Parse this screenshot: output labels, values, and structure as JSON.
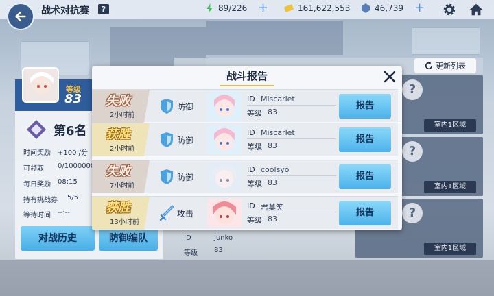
{
  "header": {
    "title": "战术对抗赛",
    "help": "?",
    "stamina": "89/226",
    "coins": "161,622,553",
    "gems": "46,739"
  },
  "player": {
    "level_label": "等级",
    "level": "83",
    "rank": "第6名"
  },
  "stats": [
    {
      "label": "时间奖励",
      "value": "+100 /分"
    },
    {
      "label": "可领取",
      "value": "0/1000000"
    },
    {
      "label": "每日奖励",
      "value": "08:15"
    },
    {
      "label": "持有挑战券",
      "value": "5/5"
    },
    {
      "label": "等待时间",
      "value": "--:--"
    }
  ],
  "buttons": {
    "history": "对战历史",
    "defense": "防御编队",
    "refresh": "更新列表"
  },
  "right_cards": {
    "question": "?",
    "area": "室内1区域",
    "bottom_id_label": "ID",
    "bottom_id": "Junko",
    "bottom_lv_label": "等级",
    "bottom_lv": "83"
  },
  "modal": {
    "title": "战斗报告",
    "id_label": "ID",
    "level_label": "等级",
    "report_label": "报告",
    "rows": [
      {
        "result": "失败",
        "result_type": "lose",
        "ago": "2小时前",
        "mode": "防御",
        "mode_icon": "shield-icon",
        "id": "Miscarlet",
        "level": "83"
      },
      {
        "result": "获胜",
        "result_type": "win",
        "ago": "2小时前",
        "mode": "防御",
        "mode_icon": "shield-icon",
        "id": "Miscarlet",
        "level": "83"
      },
      {
        "result": "失败",
        "result_type": "lose",
        "ago": "7小时前",
        "mode": "防御",
        "mode_icon": "shield-icon",
        "id": "coolsyo",
        "level": "83"
      },
      {
        "result": "获胜",
        "result_type": "win",
        "ago": "13小时前",
        "mode": "攻击",
        "mode_icon": "sword-icon",
        "id": "君莫笑",
        "level": "83"
      }
    ]
  },
  "colors": {
    "accent": "#49aee6",
    "win": "#fde27a",
    "lose": "#f4ede6",
    "header_blue": "#2f5c9a"
  }
}
